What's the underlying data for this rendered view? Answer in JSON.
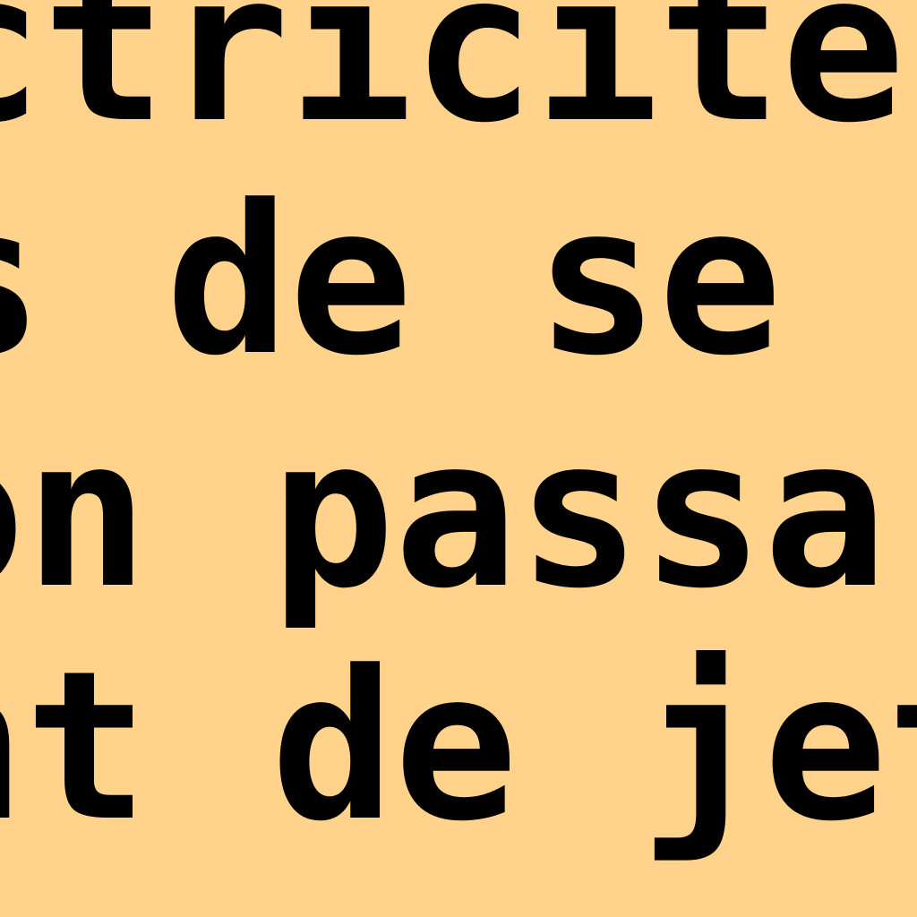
{
  "page": {
    "background": "#FFD38B",
    "text_color": "#000000"
  },
  "document": {
    "lines": [
      "ctricité, s",
      "s de se",
      "on passa",
      "nt de jet"
    ]
  }
}
